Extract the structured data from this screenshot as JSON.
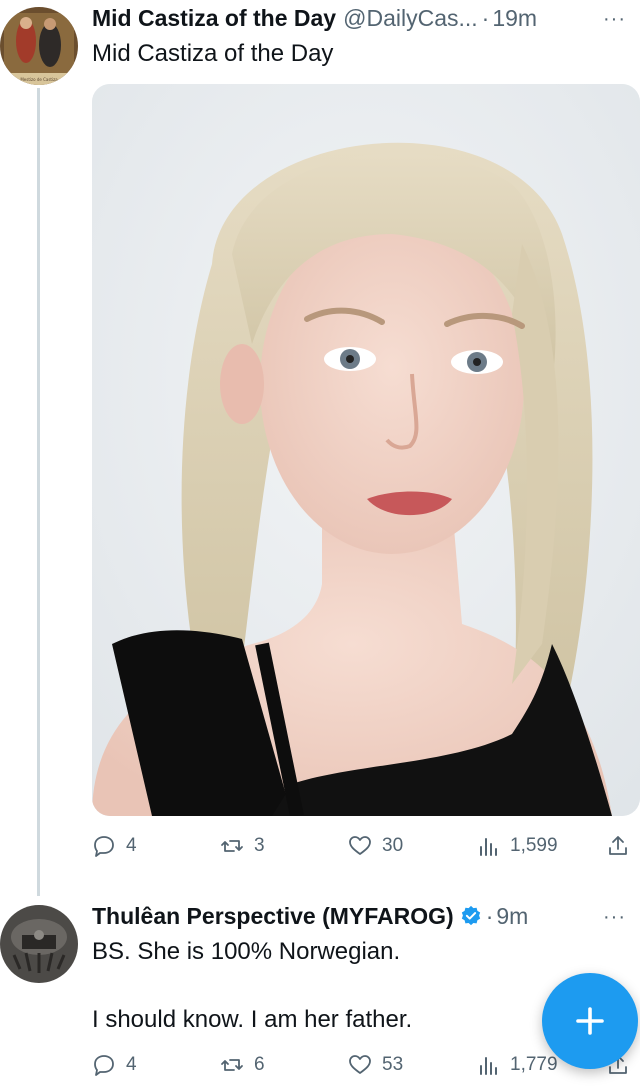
{
  "tweet1": {
    "display_name": "Mid Castiza of the Day",
    "handle": "@DailyCas...",
    "time": "19m",
    "separator": "·",
    "more": "···",
    "text": "Mid Castiza of the Day",
    "actions": {
      "replies": "4",
      "reposts": "3",
      "likes": "30",
      "views": "1,599"
    },
    "avatar_caption": "Mestizo de Castiza"
  },
  "tweet2": {
    "display_name": "Thulêan Perspective (MYFAROG)",
    "verified": true,
    "time": "9m",
    "separator": "·",
    "more": "···",
    "text_line1": "BS. She is 100% Norwegian.",
    "text_line2": "I should know. I am her father.",
    "actions": {
      "replies": "4",
      "reposts": "6",
      "likes": "53",
      "views": "1,779"
    }
  },
  "icons": [
    "reply-icon",
    "repost-icon",
    "like-icon",
    "views-icon",
    "share-icon",
    "verified-badge-icon",
    "more-icon",
    "compose-plus-icon"
  ],
  "colors": {
    "text": "#0f1419",
    "secondary": "#536471",
    "accent": "#1d9bf0",
    "thread_line": "#cfd9de"
  }
}
